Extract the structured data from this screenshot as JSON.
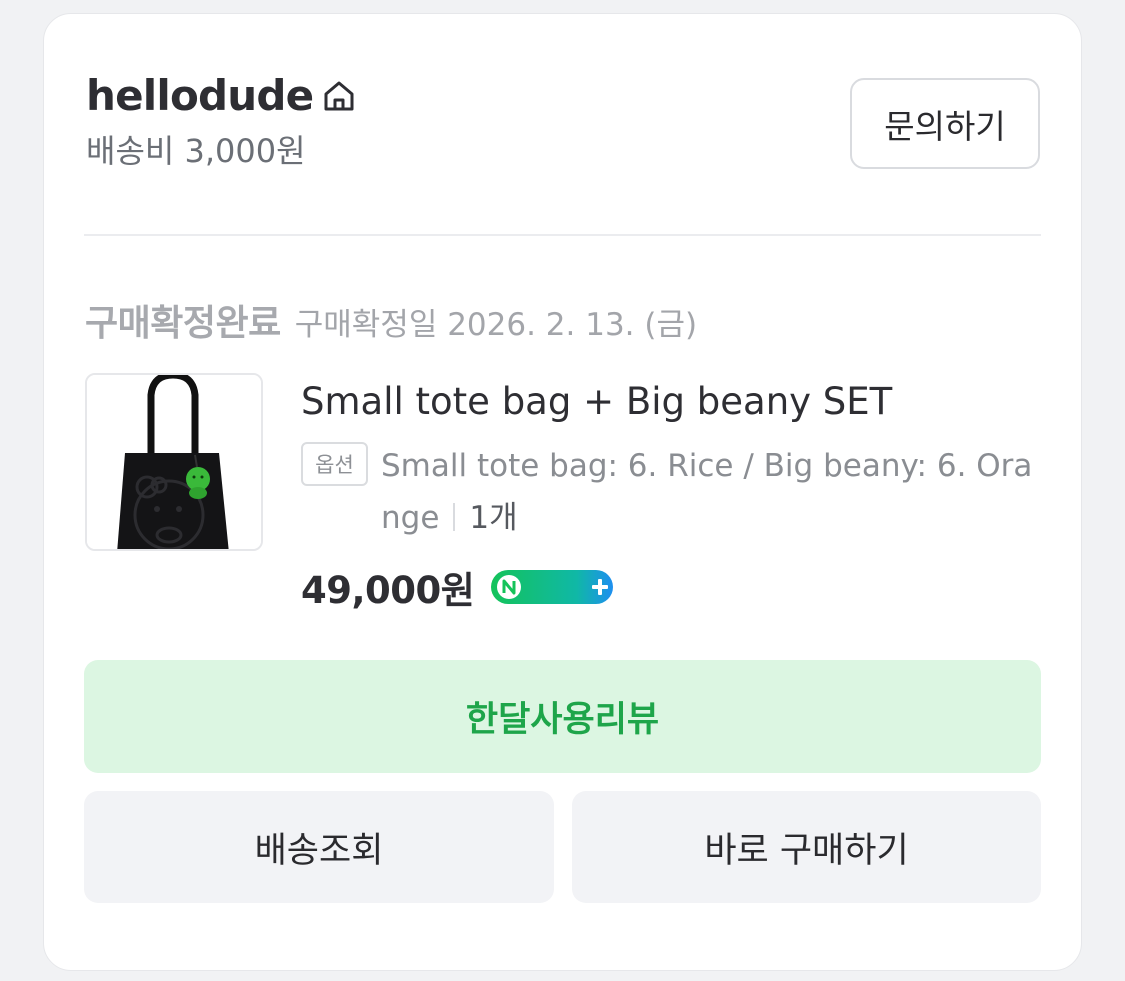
{
  "seller": {
    "name": "hellodude",
    "shipping_fee": "배송비 3,000원",
    "inquiry_label": "문의하기"
  },
  "order": {
    "status": "구매확정완료",
    "confirm_date": "구매확정일 2026. 2. 13. (금)",
    "product_name": "Small tote bag + Big beany SET",
    "option_badge": "옵션",
    "option_text": "Small tote bag: 6. Rice / Big beany: 6. Orange",
    "quantity": "1개",
    "price": "49,000원",
    "pay_badge": "npay+"
  },
  "actions": {
    "review_label": "한달사용리뷰",
    "tracking_label": "배송조회",
    "buy_again_label": "바로 구매하기"
  },
  "colors": {
    "accent_green": "#1ea54a",
    "review_bg": "#dcf6e2",
    "button_bg": "#f2f3f6"
  }
}
